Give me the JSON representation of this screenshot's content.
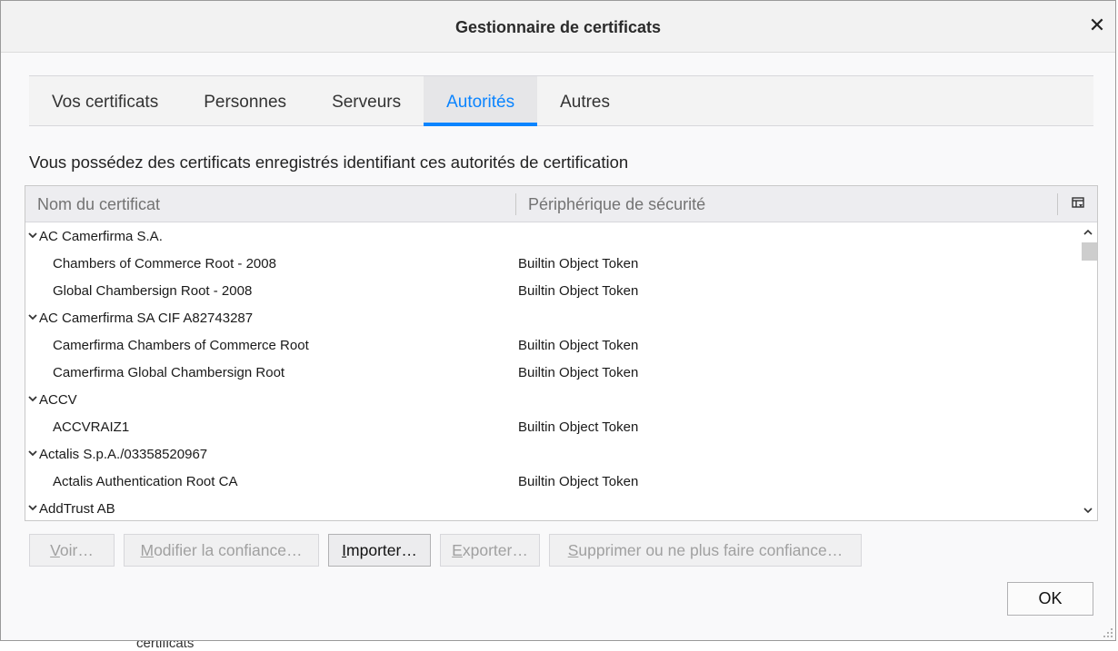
{
  "window": {
    "title": "Gestionnaire de certificats",
    "close_glyph": "✕"
  },
  "tabs": [
    {
      "label": "Vos certificats"
    },
    {
      "label": "Personnes"
    },
    {
      "label": "Serveurs"
    },
    {
      "label": "Autorités",
      "selected": true
    },
    {
      "label": "Autres"
    }
  ],
  "description": "Vous possédez des certificats enregistrés identifiant ces autorités de certification",
  "tree": {
    "columns": {
      "name": "Nom du certificat",
      "device": "Périphérique de sécurité"
    },
    "rows": [
      {
        "type": "group",
        "name": "AC Camerfirma S.A.",
        "device": ""
      },
      {
        "type": "child",
        "name": "Chambers of Commerce Root - 2008",
        "device": "Builtin Object Token"
      },
      {
        "type": "child",
        "name": "Global Chambersign Root - 2008",
        "device": "Builtin Object Token"
      },
      {
        "type": "group",
        "name": "AC Camerfirma SA CIF A82743287",
        "device": ""
      },
      {
        "type": "child",
        "name": "Camerfirma Chambers of Commerce Root",
        "device": "Builtin Object Token"
      },
      {
        "type": "child",
        "name": "Camerfirma Global Chambersign Root",
        "device": "Builtin Object Token"
      },
      {
        "type": "group",
        "name": "ACCV",
        "device": ""
      },
      {
        "type": "child",
        "name": "ACCVRAIZ1",
        "device": "Builtin Object Token"
      },
      {
        "type": "group",
        "name": "Actalis S.p.A./03358520967",
        "device": ""
      },
      {
        "type": "child",
        "name": "Actalis Authentication Root CA",
        "device": "Builtin Object Token"
      },
      {
        "type": "group",
        "name": "AddTrust AB",
        "device": ""
      }
    ]
  },
  "buttons": {
    "view": {
      "first": "V",
      "rest": "oir…"
    },
    "edit_trust": {
      "first": "M",
      "rest": "odifier la confiance…"
    },
    "import": {
      "first": "I",
      "rest": "mporter…"
    },
    "export": {
      "first": "E",
      "rest": "xporter…"
    },
    "delete": {
      "first": "S",
      "rest": "upprimer ou ne plus faire confiance…"
    },
    "ok": "OK"
  },
  "background_text": "certificats"
}
